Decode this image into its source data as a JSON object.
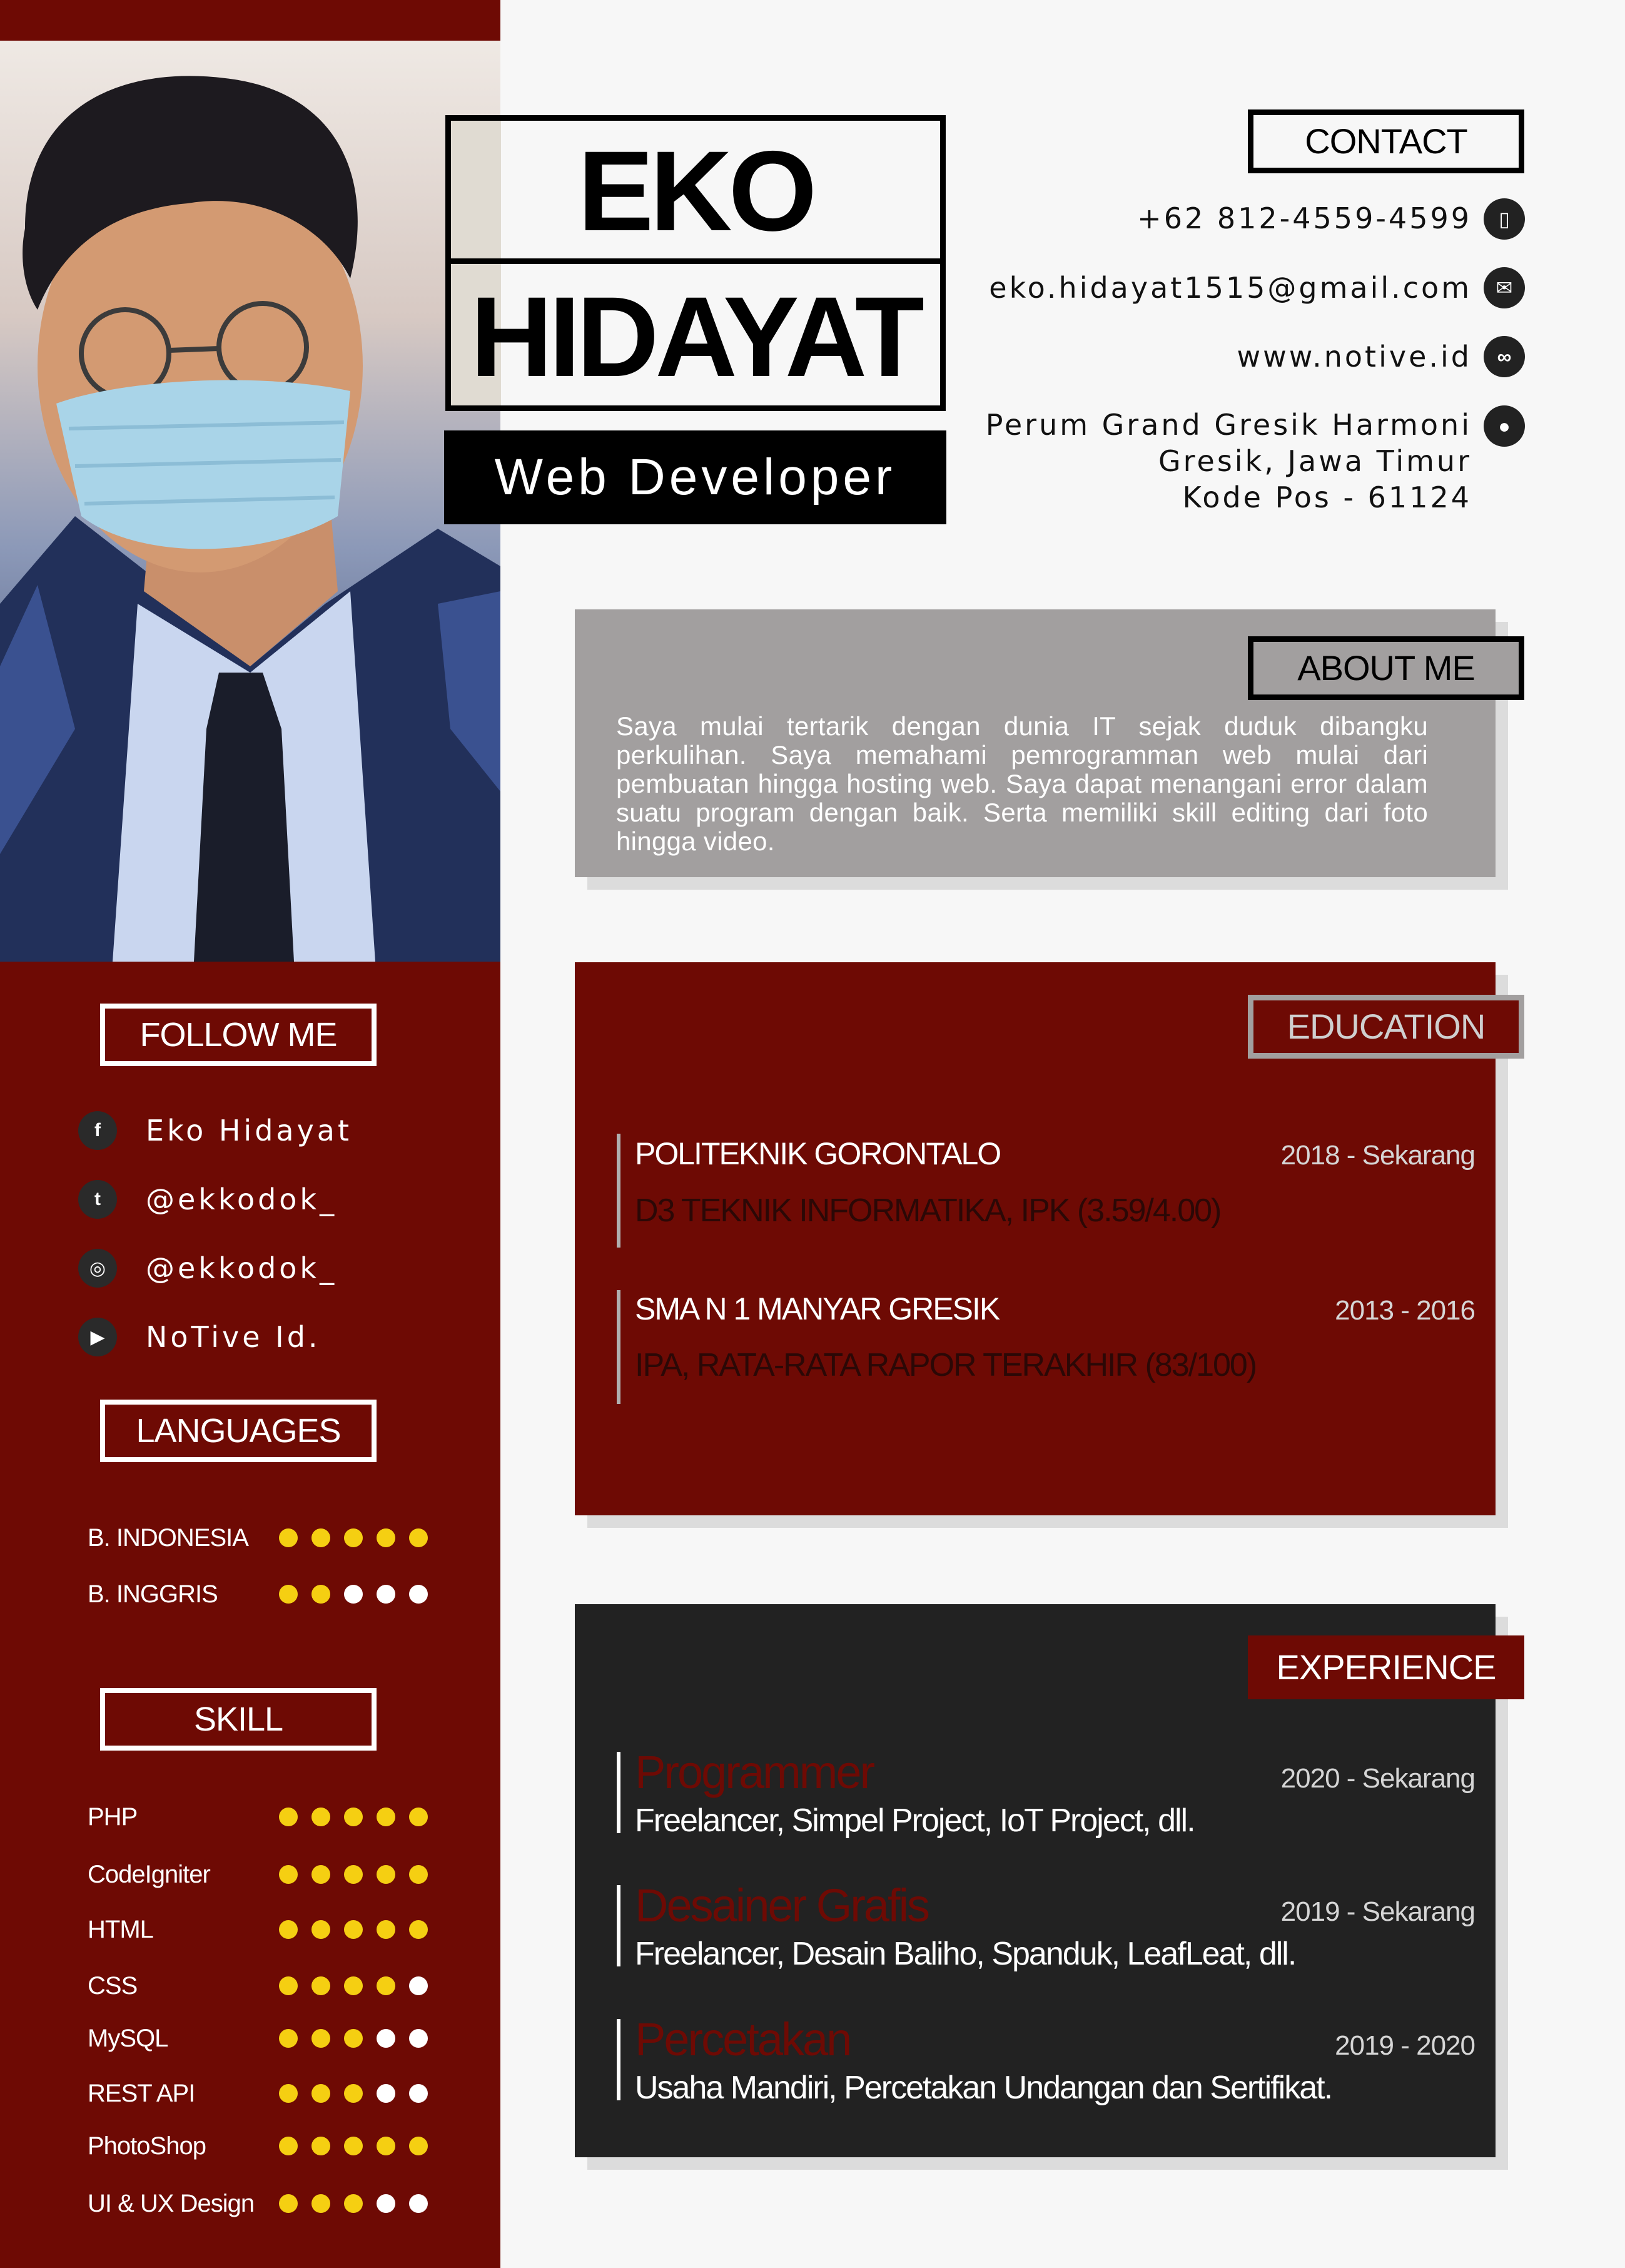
{
  "name": {
    "first": "EKO",
    "last": "HIDAYAT",
    "role": "Web Developer"
  },
  "contact": {
    "heading": "CONTACT",
    "phone": "+62 812-4559-4599",
    "email": "eko.hidayat1515@gmail.com",
    "website": "www.notive.id",
    "address": [
      "Perum Grand Gresik Harmoni",
      "Gresik, Jawa Timur",
      "Kode Pos - 61124"
    ]
  },
  "about": {
    "heading": "ABOUT ME",
    "text": "Saya mulai tertarik dengan dunia IT sejak duduk dibangku perkulihan. Saya memahami pemrogramman web mulai dari pembuatan hingga hosting web. Saya dapat menangani error dalam suatu program dengan baik. Serta memiliki skill  editing dari foto hingga video."
  },
  "follow": {
    "heading": "FOLLOW ME",
    "items": [
      {
        "icon": "facebook-icon",
        "glyph": "f",
        "label": "Eko Hidayat"
      },
      {
        "icon": "twitter-icon",
        "glyph": "t",
        "label": "@ekkodok_"
      },
      {
        "icon": "instagram-icon",
        "glyph": "◎",
        "label": "@ekkodok_"
      },
      {
        "icon": "youtube-icon",
        "glyph": "▶",
        "label": "NoTive Id."
      }
    ]
  },
  "languages": {
    "heading": "LANGUAGES",
    "items": [
      {
        "label": "B. INDONESIA",
        "level": 5
      },
      {
        "label": "B. INGGRIS",
        "level": 2
      }
    ]
  },
  "skill": {
    "heading": "SKILL",
    "items": [
      {
        "label": "PHP",
        "level": 5
      },
      {
        "label": "CodeIgniter",
        "level": 5
      },
      {
        "label": "HTML",
        "level": 5
      },
      {
        "label": "CSS",
        "level": 4
      },
      {
        "label": "MySQL",
        "level": 3
      },
      {
        "label": "REST API",
        "level": 3
      },
      {
        "label": "PhotoShop",
        "level": 5
      },
      {
        "label": "UI & UX Design",
        "level": 3
      }
    ]
  },
  "education": {
    "heading": "EDUCATION",
    "items": [
      {
        "school": "POLITEKNIK GORONTALO",
        "detail": "D3 TEKNIK INFORMATIKA, IPK (3.59/4.00)",
        "years": "2018 - Sekarang"
      },
      {
        "school": "SMA N 1 MANYAR GRESIK",
        "detail": "IPA, RATA-RATA RAPOR TERAKHIR (83/100)",
        "years": "2013 - 2016"
      }
    ]
  },
  "experience": {
    "heading": "EXPERIENCE",
    "items": [
      {
        "role": "Programmer",
        "detail": "Freelancer, Simpel Project, IoT Project, dll.",
        "years": "2020 - Sekarang"
      },
      {
        "role": "Desainer Grafis",
        "detail": "Freelancer, Desain Baliho, Spanduk, LeafLeat, dll.",
        "years": "2019 - Sekarang"
      },
      {
        "role": "Percetakan",
        "detail": "Usaha Mandiri, Percetakan Undangan dan Sertifikat.",
        "years": "2019 - 2020"
      }
    ]
  },
  "colors": {
    "maroon": "#6e0a04",
    "dark": "#222222",
    "grey": "#a29f9f",
    "dot_on": "#f5cf12",
    "dot_off": "#ffffff"
  }
}
